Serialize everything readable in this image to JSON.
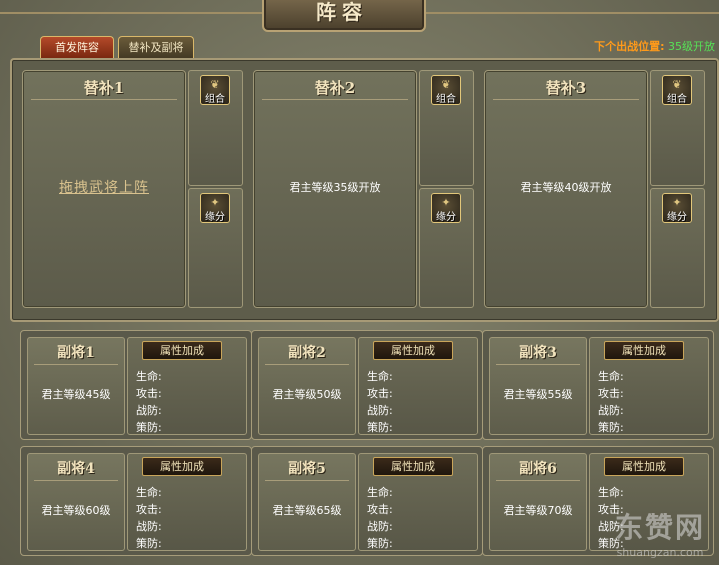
{
  "header": {
    "title": "阵容"
  },
  "tabs": [
    {
      "label": "首发阵容",
      "active": true
    },
    {
      "label": "替补及副将",
      "active": false
    }
  ],
  "next_position": {
    "label": "下个出战位置:",
    "value": "35级开放"
  },
  "subs": [
    {
      "title": "替补1",
      "message": "拖拽武将上阵",
      "combo_label": "组合",
      "fate_label": "缘分"
    },
    {
      "title": "替补2",
      "message": "君主等级35级开放",
      "combo_label": "组合",
      "fate_label": "缘分"
    },
    {
      "title": "替补3",
      "message": "君主等级40级开放",
      "combo_label": "组合",
      "fate_label": "缘分"
    }
  ],
  "deputies": [
    {
      "title": "副将1",
      "message": "君主等级45级"
    },
    {
      "title": "副将2",
      "message": "君主等级50级"
    },
    {
      "title": "副将3",
      "message": "君主等级55级"
    },
    {
      "title": "副将4",
      "message": "君主等级60级"
    },
    {
      "title": "副将5",
      "message": "君主等级65级"
    },
    {
      "title": "副将6",
      "message": "君主等级70级"
    }
  ],
  "attr_button_label": "属性加成",
  "stats_labels": {
    "hp": "生命:",
    "attack": "攻击:",
    "war_def": "战防:",
    "strat_def": "策防:"
  },
  "watermark": {
    "line1": "东赞网",
    "line2": "shuangzan.com"
  },
  "colors": {
    "active_tab": "#b44a2a",
    "next_label": "#ff9a1a",
    "next_value": "#57e257"
  }
}
